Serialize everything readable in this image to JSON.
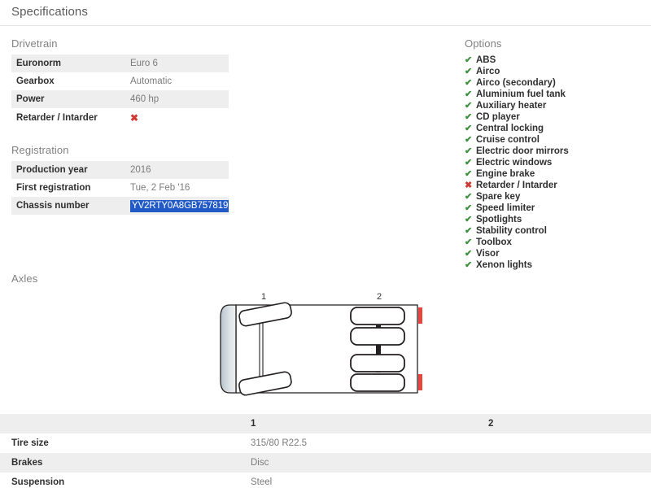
{
  "header": {
    "title": "Specifications"
  },
  "drivetrain": {
    "title": "Drivetrain",
    "rows": [
      {
        "label": "Euronorm",
        "value": "Euro 6",
        "type": "text"
      },
      {
        "label": "Gearbox",
        "value": "Automatic",
        "type": "text"
      },
      {
        "label": "Power",
        "value": "460 hp",
        "type": "text"
      },
      {
        "label": "Retarder / Intarder",
        "value": "✖",
        "type": "cross"
      }
    ]
  },
  "registration": {
    "title": "Registration",
    "rows": [
      {
        "label": "Production year",
        "value": "2016",
        "type": "text"
      },
      {
        "label": "First registration",
        "value": "Tue, 2 Feb '16",
        "type": "text"
      },
      {
        "label": "Chassis number",
        "value": "YV2RTY0A8GB757819",
        "type": "selected"
      }
    ]
  },
  "options": {
    "title": "Options",
    "items": [
      {
        "label": "ABS",
        "available": true,
        "icon": "check-icon",
        "glyph": "✔"
      },
      {
        "label": "Airco",
        "available": true,
        "icon": "check-icon",
        "glyph": "✔"
      },
      {
        "label": "Airco (secondary)",
        "available": true,
        "icon": "check-icon",
        "glyph": "✔"
      },
      {
        "label": "Aluminium fuel tank",
        "available": true,
        "icon": "check-icon",
        "glyph": "✔"
      },
      {
        "label": "Auxiliary heater",
        "available": true,
        "icon": "check-icon",
        "glyph": "✔"
      },
      {
        "label": "CD player",
        "available": true,
        "icon": "check-icon",
        "glyph": "✔"
      },
      {
        "label": "Central locking",
        "available": true,
        "icon": "check-icon",
        "glyph": "✔"
      },
      {
        "label": "Cruise control",
        "available": true,
        "icon": "check-icon",
        "glyph": "✔"
      },
      {
        "label": "Electric door mirrors",
        "available": true,
        "icon": "check-icon",
        "glyph": "✔"
      },
      {
        "label": "Electric windows",
        "available": true,
        "icon": "check-icon",
        "glyph": "✔"
      },
      {
        "label": "Engine brake",
        "available": true,
        "icon": "check-icon",
        "glyph": "✔"
      },
      {
        "label": "Retarder / Intarder",
        "available": false,
        "icon": "cross-icon",
        "glyph": "✖"
      },
      {
        "label": "Spare key",
        "available": true,
        "icon": "check-icon",
        "glyph": "✔"
      },
      {
        "label": "Speed limiter",
        "available": true,
        "icon": "check-icon",
        "glyph": "✔"
      },
      {
        "label": "Spotlights",
        "available": true,
        "icon": "check-icon",
        "glyph": "✔"
      },
      {
        "label": "Stability control",
        "available": true,
        "icon": "check-icon",
        "glyph": "✔"
      },
      {
        "label": "Toolbox",
        "available": true,
        "icon": "check-icon",
        "glyph": "✔"
      },
      {
        "label": "Visor",
        "available": true,
        "icon": "check-icon",
        "glyph": "✔"
      },
      {
        "label": "Xenon lights",
        "available": true,
        "icon": "check-icon",
        "glyph": "✔"
      }
    ]
  },
  "axles": {
    "title": "Axles",
    "diagram": {
      "axle_labels": [
        "1",
        "2"
      ],
      "axle_1_type": "steered-single-tire",
      "axle_2_type": "driven-dual-tire",
      "marker_color": "#e8453c"
    },
    "table": {
      "headers": [
        "",
        "1",
        "2"
      ],
      "rows": [
        {
          "label": "Tire size",
          "axle1": "315/80 R22.5",
          "axle2": ""
        },
        {
          "label": "Brakes",
          "axle1": "Disc",
          "axle2": ""
        },
        {
          "label": "Suspension",
          "axle1": "Steel",
          "axle2": ""
        }
      ]
    }
  },
  "colors": {
    "stripe": "#eeeeee",
    "selection": "#2159c6",
    "check_green": "#3c8f3c",
    "cross_red": "#cf3a35"
  }
}
